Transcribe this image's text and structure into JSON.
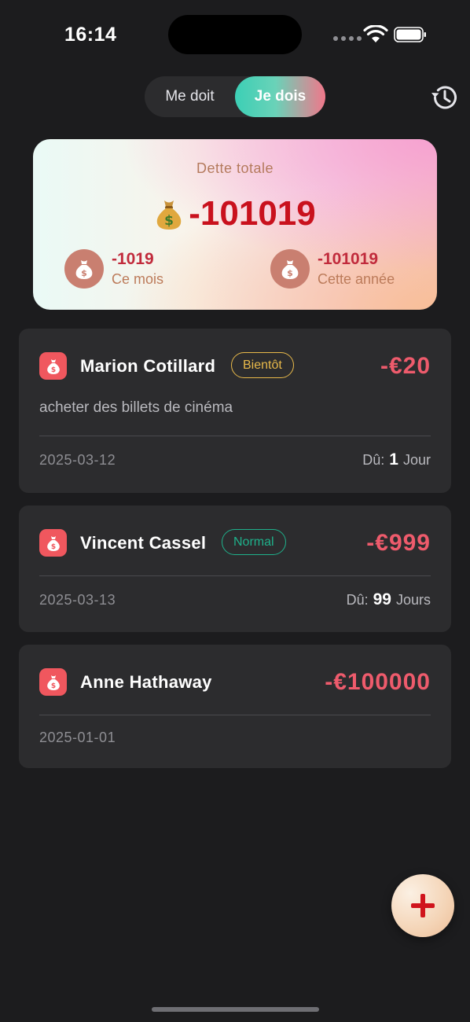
{
  "status_bar": {
    "time": "16:14"
  },
  "segment": {
    "option_owed_to_me": "Me doit",
    "option_i_owe": "Je dois",
    "selected": "Je dois"
  },
  "summary": {
    "title": "Dette totale",
    "total": "-101019",
    "month_value": "-1019",
    "month_label": "Ce mois",
    "year_value": "-101019",
    "year_label": "Cette année"
  },
  "debts": [
    {
      "name": "Marion Cotillard",
      "badge": "Bientôt",
      "amount": "-€20",
      "description": "acheter des billets de cinéma",
      "date": "2025-03-12",
      "due_label": "Dû:",
      "due_value": "1",
      "due_unit": "Jour"
    },
    {
      "name": "Vincent Cassel",
      "badge": "Normal",
      "amount": "-€999",
      "date": "2025-03-13",
      "due_label": "Dû:",
      "due_value": "99",
      "due_unit": "Jours"
    },
    {
      "name": "Anne Hathaway",
      "amount": "-€100000",
      "date": "2025-01-01"
    }
  ],
  "colors": {
    "accent_red": "#c9111d",
    "amount_red": "#ee5b6c",
    "badge_soon": "#e8b94a",
    "badge_normal": "#1fb18b"
  },
  "icons": {
    "history": "history-icon",
    "add": "plus-icon",
    "debt": "money-bag-icon"
  }
}
